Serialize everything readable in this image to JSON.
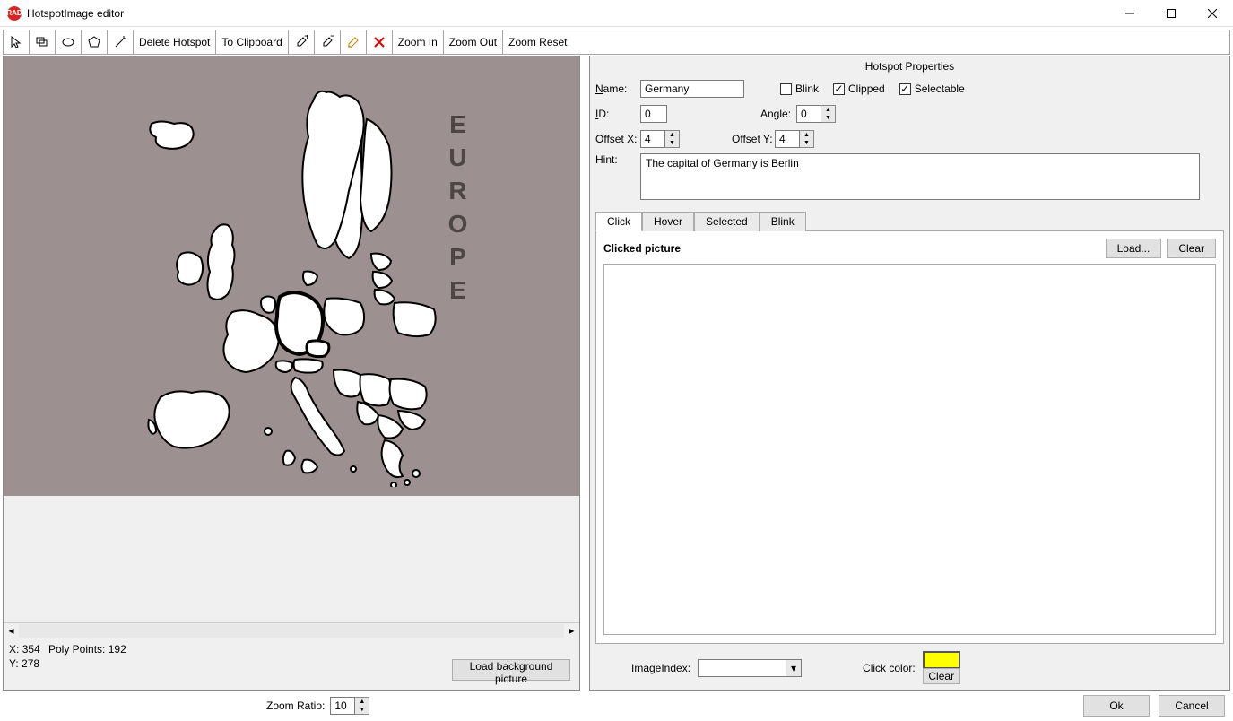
{
  "window": {
    "title": "HotspotImage editor",
    "icon_label": "RAD"
  },
  "toolbar": {
    "delete_hotspot": "Delete Hotspot",
    "to_clipboard": "To Clipboard",
    "zoom_in": "Zoom In",
    "zoom_out": "Zoom Out",
    "zoom_reset": "Zoom Reset"
  },
  "canvas": {
    "label": "EUROPE"
  },
  "status": {
    "x_label": "X:",
    "x_value": "354",
    "y_label": "Y:",
    "y_value": "278",
    "poly_label": "Poly Points:",
    "poly_value": "192",
    "load_bg": "Load background picture"
  },
  "props": {
    "panel_title": "Hotspot Properties",
    "name_label": "Name:",
    "name_value": "Germany",
    "blink_label": "Blink",
    "blink_checked": false,
    "clipped_label": "Clipped",
    "clipped_checked": true,
    "selectable_label": "Selectable",
    "selectable_checked": true,
    "id_label": "ID:",
    "id_value": "0",
    "angle_label": "Angle:",
    "angle_value": "0",
    "offsetx_label": "Offset X:",
    "offsetx_value": "4",
    "offsety_label": "Offset Y:",
    "offsety_value": "4",
    "hint_label": "Hint:",
    "hint_value": "The capital of Germany is Berlin"
  },
  "tabs": {
    "click": "Click",
    "hover": "Hover",
    "selected": "Selected",
    "blink": "Blink",
    "click_head": "Clicked picture",
    "load": "Load...",
    "clear": "Clear",
    "image_index": "ImageIndex:",
    "click_color": "Click color:",
    "click_color_value": "#ffff00",
    "clear_small": "Clear"
  },
  "footer": {
    "zoom_ratio_label": "Zoom Ratio:",
    "zoom_ratio_value": "10",
    "ok": "Ok",
    "cancel": "Cancel"
  }
}
